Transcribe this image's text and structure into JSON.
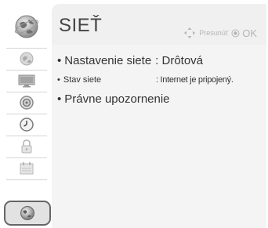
{
  "header": {
    "title": "SIEŤ",
    "hint_move": "Presunúť",
    "hint_ok": "OK"
  },
  "sidebar": {
    "items": [
      {
        "icon": "picture-icon"
      },
      {
        "icon": "monitor-icon"
      },
      {
        "icon": "speaker-icon"
      },
      {
        "icon": "clock-icon"
      },
      {
        "icon": "lock-icon"
      },
      {
        "icon": "calendar-icon"
      },
      {
        "icon": "network-globe-icon",
        "selected": true
      }
    ],
    "top_icon": "network-globe-icon"
  },
  "rows": [
    {
      "bullet": "•",
      "label": "Nastavenie siete",
      "value": ": Drôtová"
    },
    {
      "bullet": "•",
      "label": "Stav siete",
      "value": ": Internet je pripojený."
    },
    {
      "bullet": "•",
      "label": "Právne upozornenie",
      "value": ""
    }
  ],
  "colors": {
    "panel": "#f0f0f0",
    "text": "#333333",
    "hint": "#b5b5b5",
    "selected_border": "#666666"
  }
}
